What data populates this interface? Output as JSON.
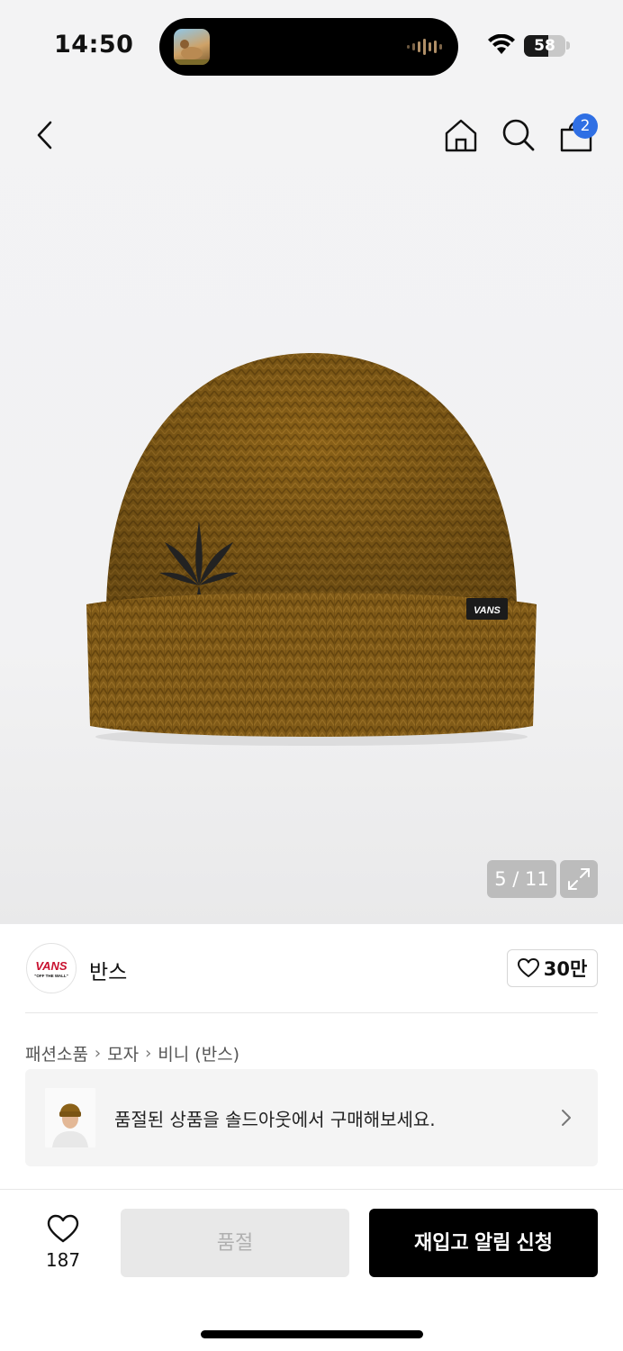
{
  "status_bar": {
    "time": "14:50",
    "battery_percent": "58",
    "battery_level": 0.58
  },
  "nav": {
    "cart_count": "2",
    "accent_color": "#2f6fe4"
  },
  "gallery": {
    "counter": "5 / 11"
  },
  "brand": {
    "name": "반스",
    "logo_text": "VANS",
    "logo_sub": "\"OFF THE WALL\"",
    "like_count": "30만"
  },
  "breadcrumb": [
    "패션소품",
    "모자",
    "비니 (반스)"
  ],
  "soldout_banner": {
    "text": "품절된 상품을 솔드아웃에서 구매해보세요."
  },
  "product_label": "VANS",
  "bottom_bar": {
    "like_count": "187",
    "soldout_label": "품절",
    "restock_label": "재입고 알림 신청"
  }
}
